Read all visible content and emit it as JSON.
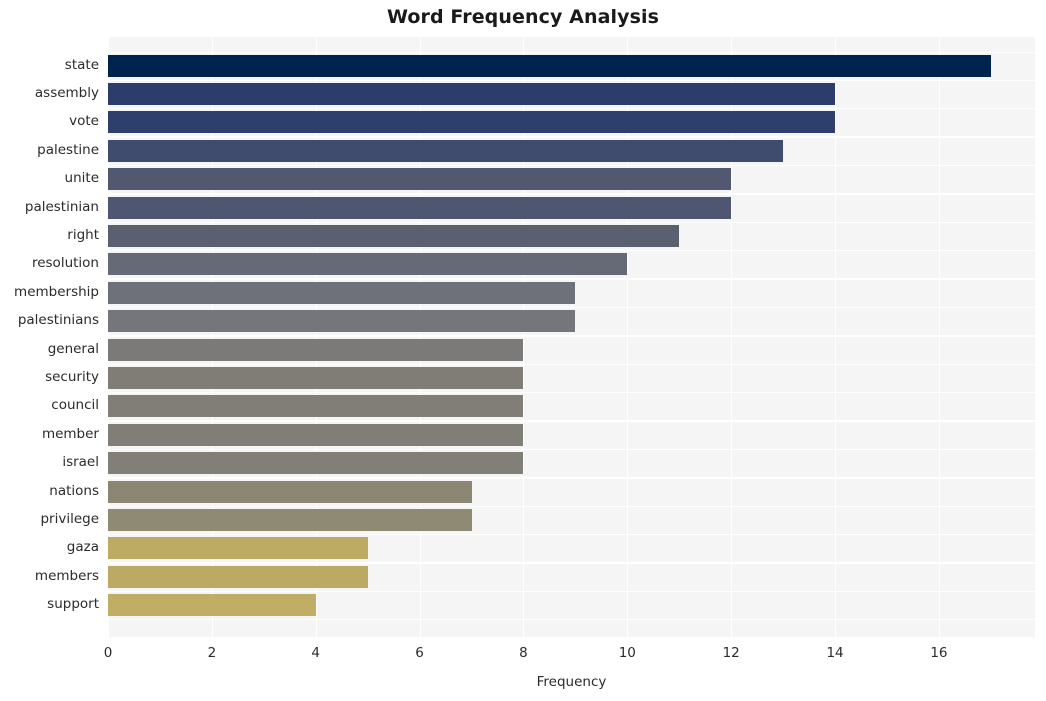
{
  "chart_data": {
    "type": "bar",
    "orientation": "horizontal",
    "title": "Word Frequency Analysis",
    "xlabel": "Frequency",
    "ylabel": "",
    "categories": [
      "state",
      "assembly",
      "vote",
      "palestine",
      "unite",
      "palestinian",
      "right",
      "resolution",
      "membership",
      "palestinians",
      "general",
      "security",
      "council",
      "member",
      "israel",
      "nations",
      "privilege",
      "gaza",
      "members",
      "support"
    ],
    "values": [
      17,
      14,
      14,
      13,
      12,
      12,
      11,
      10,
      9,
      9,
      8,
      8,
      8,
      8,
      8,
      7,
      7,
      5,
      5,
      4
    ],
    "bar_colors": [
      "#00234d",
      "#2c3c6b",
      "#2e3f6e",
      "#404c6e",
      "#515870",
      "#4e5671",
      "#5b6070",
      "#666a76",
      "#6e707a",
      "#75767b",
      "#7c7a78",
      "#807d77",
      "#817e78",
      "#817e78",
      "#827e78",
      "#8c8773",
      "#8f8a74",
      "#bdab63",
      "#bcaa64",
      "#c0ae66"
    ],
    "xlim": [
      0,
      17.85
    ],
    "xticks": [
      0,
      2,
      4,
      6,
      8,
      10,
      12,
      14,
      16
    ],
    "xticklabels": [
      "0",
      "2",
      "4",
      "6",
      "8",
      "10",
      "12",
      "14",
      "16"
    ],
    "grid": true,
    "grid_color": "#ffffff",
    "plot_background": "#f5f5f6",
    "figure_background": "#ffffff",
    "legend": null
  }
}
